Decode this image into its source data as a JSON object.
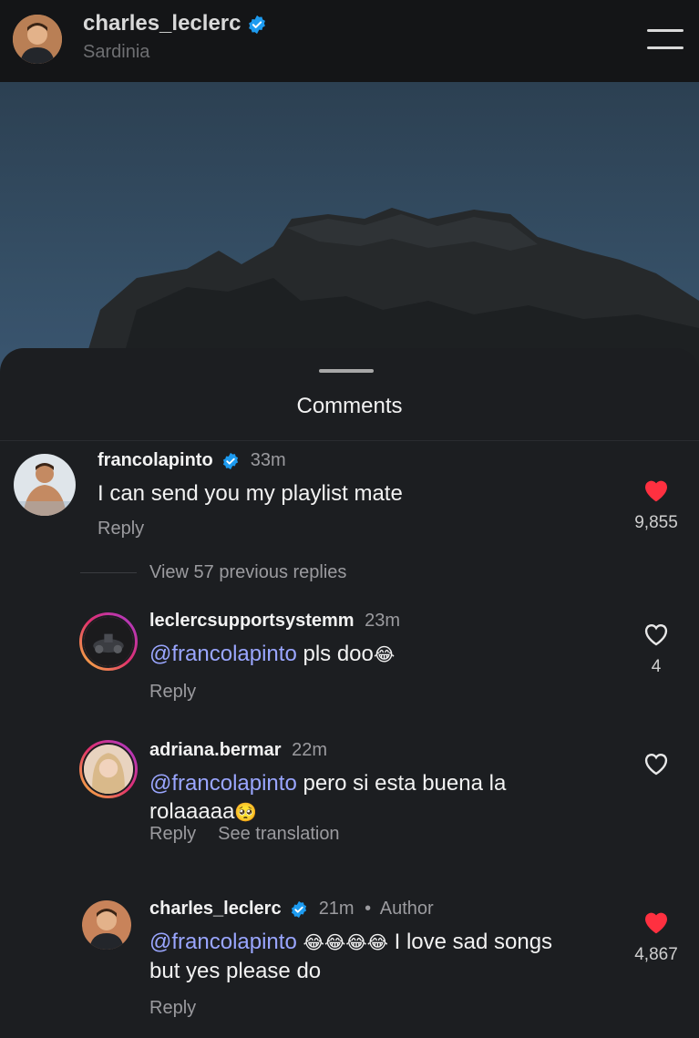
{
  "header": {
    "username": "charles_leclerc",
    "location": "Sardinia"
  },
  "sheet": {
    "title": "Comments"
  },
  "comments": [
    {
      "username": "francolapinto",
      "verified": true,
      "time": "33m",
      "text": "I can send you my playlist mate",
      "reply_label": "Reply",
      "liked": true,
      "like_count": "9,855"
    }
  ],
  "view_replies": "View 57 previous replies",
  "replies": [
    {
      "username": "leclercsupportsystemm",
      "time": "23m",
      "mention": "@francolapinto",
      "text": " pls doo",
      "emoji": "😂",
      "reply_label": "Reply",
      "liked": false,
      "like_count": "4"
    },
    {
      "username": "adriana.bermar",
      "time": "22m",
      "mention": "@francolapinto",
      "text": " pero si esta buena la rolaaaaa",
      "emoji": "🥺",
      "reply_label": "Reply",
      "translate_label": "See translation",
      "liked": false,
      "like_count": ""
    },
    {
      "username": "charles_leclerc",
      "verified": true,
      "time": "21m",
      "author_tag": "Author",
      "mention": "@francolapinto",
      "emoji": "😂😂😂😂",
      "text": " I love sad songs but yes please do",
      "reply_label": "Reply",
      "liked": true,
      "like_count": "4,867"
    }
  ],
  "colors": {
    "like_red": "#ff3040",
    "mention_blue": "#9aa6ff",
    "verified_blue": "#1d9bf0"
  },
  "icons": {
    "verified": "verified-badge-icon",
    "menu": "menu-icon",
    "heart_filled": "heart-filled-icon",
    "heart_outline": "heart-outline-icon"
  }
}
